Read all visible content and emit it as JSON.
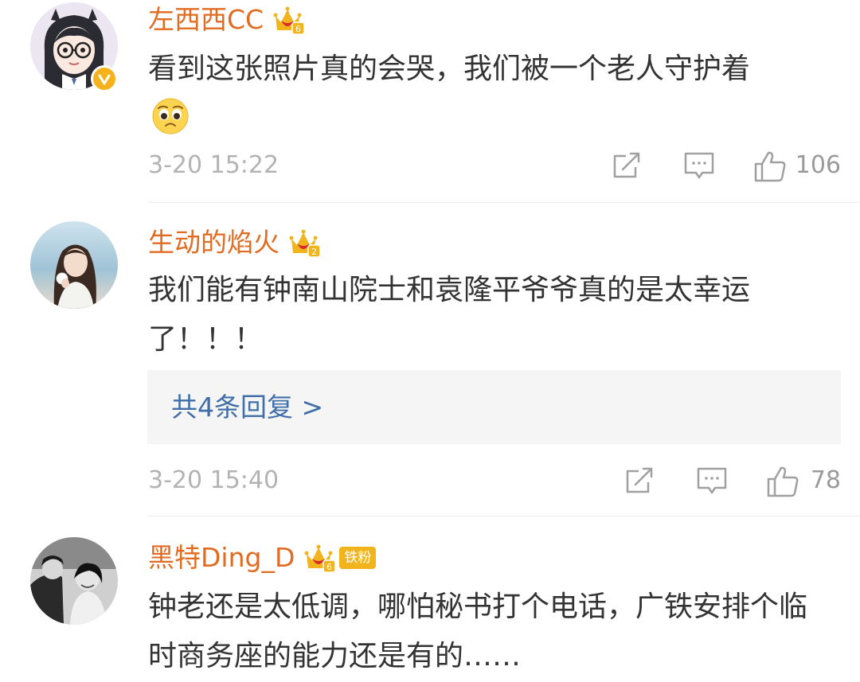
{
  "comments": [
    {
      "username": "左西西CC",
      "badge_level": "6",
      "verified": true,
      "text": "看到这张照片真的会哭，我们被一个老人守护着",
      "emoji": "pleading-face-emoji",
      "timestamp": "3-20 15:22",
      "likes": "106"
    },
    {
      "username": "生动的焰火",
      "badge_level": "2",
      "text": "我们能有钟南山院士和袁隆平爷爷真的是太幸运了！！！",
      "replies_label": "共4条回复 >",
      "timestamp": "3-20 15:40",
      "likes": "78"
    },
    {
      "username": "黑特Ding_D",
      "badge_level": "6",
      "fan_badge": "铁粉",
      "text": "钟老还是太低调，哪怕秘书打个电话，广铁安排个临时商务座的能力还是有的……"
    }
  ],
  "icons": {
    "share": "share-icon",
    "comment": "comment-icon",
    "like": "thumbs-up-icon",
    "crown_badge": "crown-badge-icon",
    "verified": "verified-v-icon"
  },
  "colors": {
    "username": "#e26b22",
    "reply_link": "#3f6ea8",
    "badge_gold": "#f2b41c",
    "meta_gray": "#b3b3b3"
  }
}
